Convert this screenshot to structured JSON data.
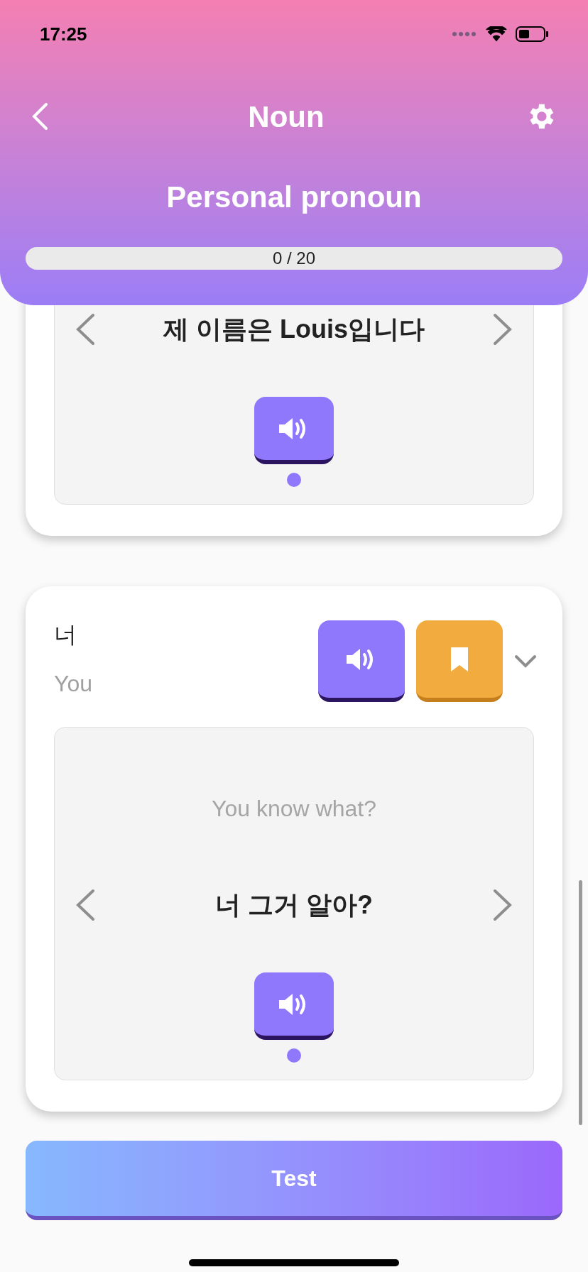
{
  "status_bar": {
    "time": "17:25"
  },
  "header": {
    "title": "Noun",
    "subtitle": "Personal pronoun",
    "progress": {
      "text": "0 / 20",
      "level": 0
    }
  },
  "cards": [
    {
      "example": {
        "sentence": "제 이름은 Louis입니다",
        "dots": [
          {
            "selected": true
          }
        ]
      }
    },
    {
      "word": "너",
      "meaning": "You",
      "example": {
        "translation": "You know what?",
        "sentence": "너 그거 알아?",
        "dots": [
          {
            "selected": true
          }
        ]
      }
    }
  ],
  "test_button": "Test"
}
